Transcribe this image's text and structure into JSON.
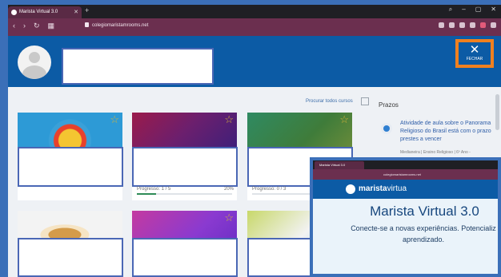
{
  "browser": {
    "tab_title": "Marista Virtual 3.0",
    "url": "colegiomaristamrooms.net"
  },
  "header": {
    "close_label": "FECHAR"
  },
  "courses": {
    "search_link": "Procurar todos cursos",
    "cards": [
      {
        "progress_label": "",
        "progress_pct": ""
      },
      {
        "progress_label": "Progresso: 1 / 5",
        "progress_pct": "20%",
        "progress_value": 0.2
      },
      {
        "progress_label": "Progresso: 0 / 3",
        "progress_pct": "",
        "progress_value": 0.0
      }
    ]
  },
  "deadlines": {
    "title": "Prazos",
    "item_title": "Atividade de aula sobre o Panorama Religioso do Brasil está com o prazo prestes a vencer",
    "item_sub": "Medianeira | Ensino Religioso | 6º Ano -"
  },
  "popup": {
    "tab_title": "Marista Virtual 3.0",
    "url": "colegiomaristamrooms.net",
    "brand_bold": "marista",
    "brand_light": "virtua",
    "headline": "Marista Virtual 3.0",
    "subtitle_line1": "Conecte-se a novas experiências. Potencializ",
    "subtitle_line2": "aprendizado."
  }
}
